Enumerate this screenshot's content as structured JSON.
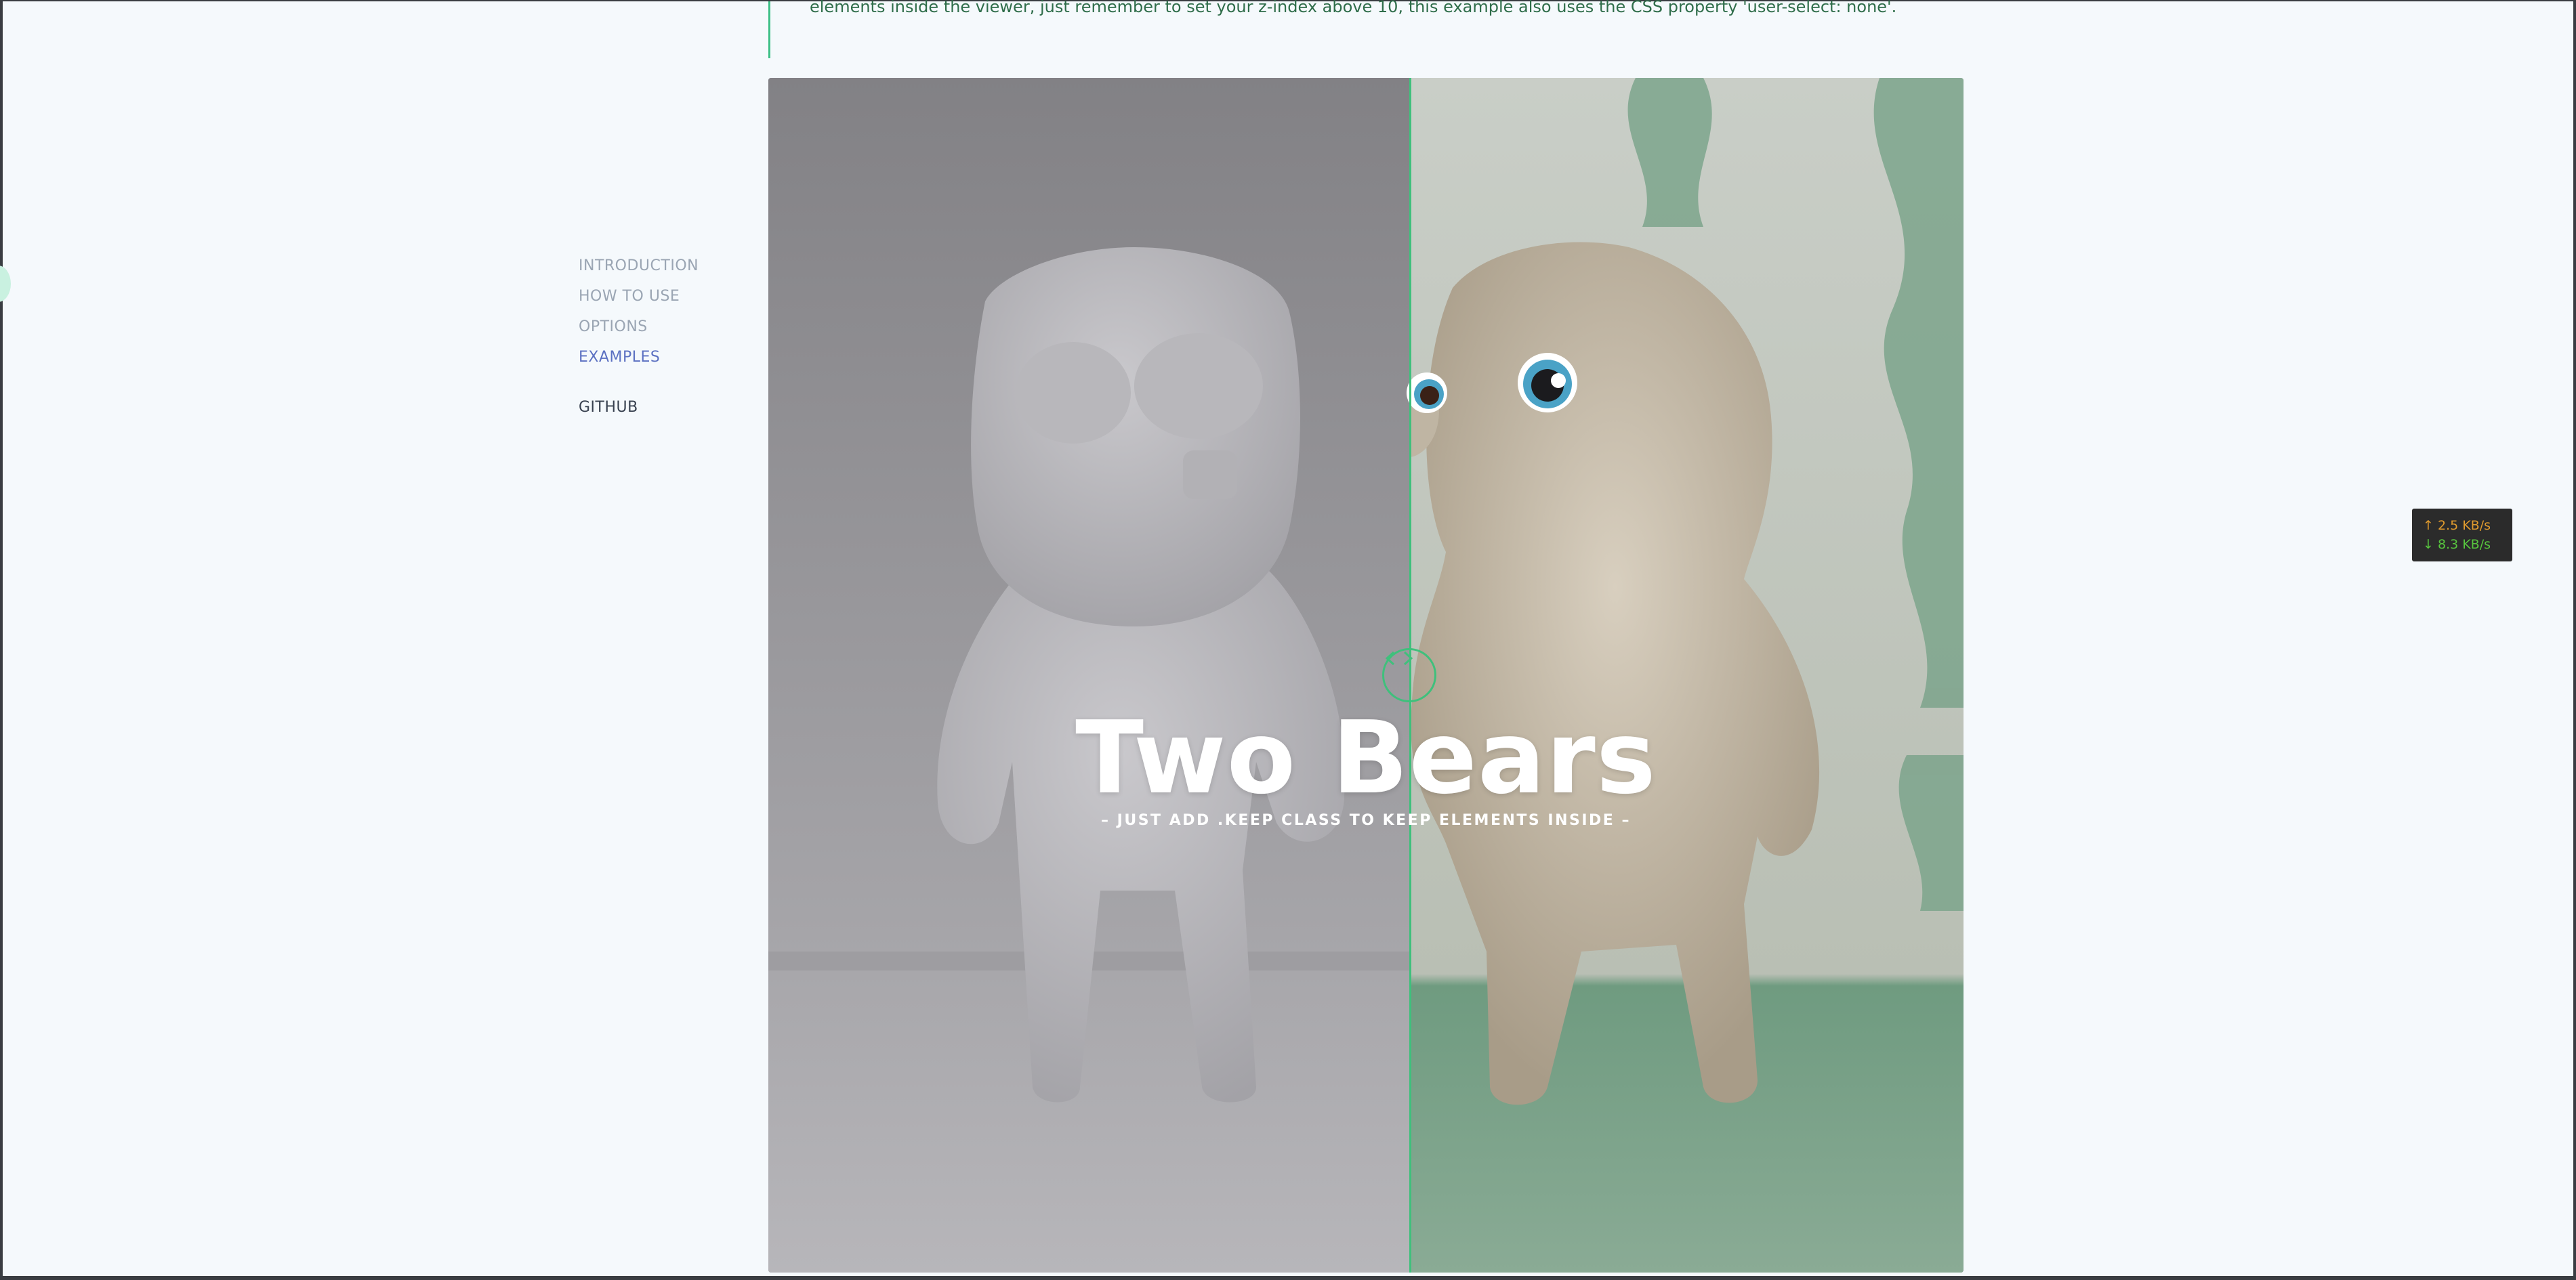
{
  "intro": {
    "text": "elements inside the viewer, just remember to set your z-index above 10, this example also uses the CSS property 'user-select: none'."
  },
  "nav": {
    "items": [
      {
        "label": "INTRODUCTION"
      },
      {
        "label": "HOW TO USE"
      },
      {
        "label": "OPTIONS"
      },
      {
        "label": "EXAMPLES"
      }
    ],
    "active": "EXAMPLES",
    "github_label": "GITHUB"
  },
  "viewer": {
    "title": "Two Bears",
    "subtitle": "– JUST ADD .KEEP CLASS TO KEEP ELEMENTS INSIDE –",
    "accent_color": "#3fc07c",
    "handle_icon": "left-right-arrows-icon"
  },
  "speed_widget": {
    "upload": "↑ 2.5 KB/s",
    "download": "↓ 8.3 KB/s"
  }
}
